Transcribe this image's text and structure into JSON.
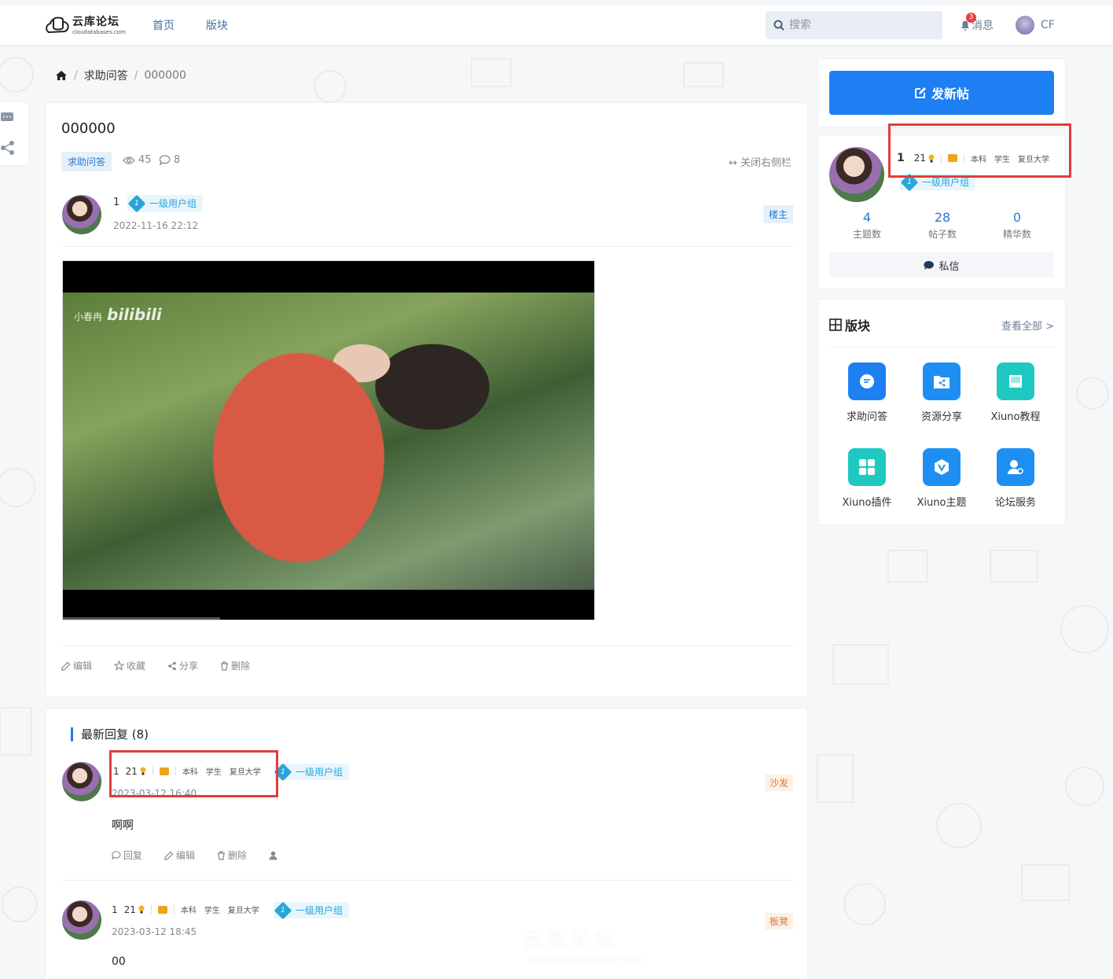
{
  "nav": {
    "logo_cn": "云库论坛",
    "logo_en": "cloudatabases.com",
    "links": [
      "首页",
      "版块"
    ],
    "search_placeholder": "搜索",
    "message_label": "消息",
    "message_count": "3",
    "user_name": "CF"
  },
  "breadcrumb": {
    "items": [
      "求助问答",
      "000000"
    ]
  },
  "post": {
    "title": "000000",
    "forum_tag": "求助问答",
    "views": "45",
    "comments": "8",
    "close_sidebar": "关闭右侧栏",
    "author": "1",
    "group": "一级用户组",
    "group_level": "1",
    "date": "2022-11-16 22:12",
    "owner_tag": "楼主",
    "video_watermark": "小春冉",
    "video_brand": "bilibili",
    "actions": [
      "编辑",
      "收藏",
      "分享",
      "删除"
    ]
  },
  "replies": {
    "heading": "最新回复 (8)",
    "items": [
      {
        "author": "1",
        "coins": "21",
        "edu": [
          "本科",
          "学生",
          "复旦大学"
        ],
        "group": "一级用户组",
        "group_level": "1",
        "date": "2023-03-12 16:40",
        "floor": "沙发",
        "content": "啊啊",
        "actions": [
          "回复",
          "编辑",
          "删除"
        ]
      },
      {
        "author": "1",
        "coins": "21",
        "edu": [
          "本科",
          "学生",
          "复旦大学"
        ],
        "group": "一级用户组",
        "group_level": "1",
        "date": "2023-03-12 18:45",
        "floor": "板凳",
        "content": "00"
      }
    ]
  },
  "sidebar": {
    "new_post": "发新帖",
    "user": {
      "name": "1",
      "coins": "21",
      "edu": [
        "本科",
        "学生",
        "复旦大学"
      ],
      "group": "一级用户组",
      "stats": [
        {
          "value": "4",
          "label": "主题数"
        },
        {
          "value": "28",
          "label": "帖子数"
        },
        {
          "value": "0",
          "label": "精华数"
        }
      ],
      "pm": "私信"
    },
    "forums": {
      "title": "版块",
      "more": "查看全部 >",
      "items": [
        {
          "label": "求助问答",
          "color": "#1e7ff2",
          "icon": "chat-icon"
        },
        {
          "label": "资源分享",
          "color": "#1e8ff2",
          "icon": "folder-share-icon"
        },
        {
          "label": "Xiuno教程",
          "color": "#1fc8c0",
          "icon": "book-icon"
        },
        {
          "label": "Xiuno插件",
          "color": "#1fc8c0",
          "icon": "grid-icon"
        },
        {
          "label": "Xiuno主题",
          "color": "#1e8ff2",
          "icon": "shield-v-icon"
        },
        {
          "label": "论坛服务",
          "color": "#1e8ff2",
          "icon": "user-service-icon"
        }
      ]
    }
  },
  "watermark": {
    "cn": "云库论坛",
    "en": "cloudatabases.com"
  },
  "colors": {
    "accent": "#1e7ff2",
    "highlight_box": "#e03c3c",
    "group": "#2aa5d8"
  }
}
